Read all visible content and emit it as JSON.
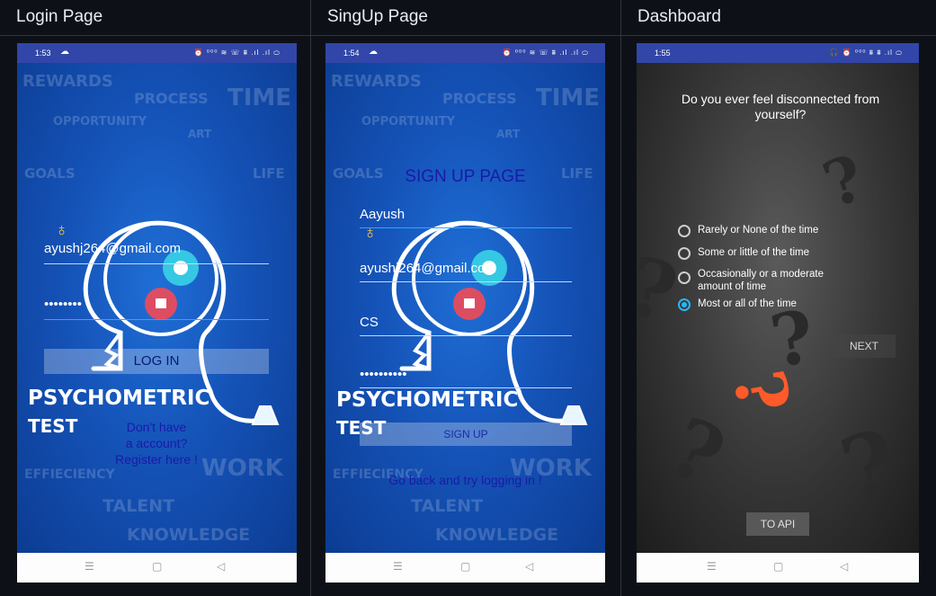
{
  "columns": [
    "Login Page",
    "SingUp Page",
    "Dashboard"
  ],
  "login": {
    "time": "1:53",
    "status_icons": "⏰ ⁰⁰⁰ ≋ ☏ ⩩ .ıl .ıl ⬭",
    "email_value": "ayushj264@gmail.com",
    "password_value": "••••••••",
    "login_button": "LOG IN",
    "brand_line1": "PSYCHOMETRIC",
    "brand_line2": "TEST",
    "register_text": "Don't have\na account?\nRegister here !"
  },
  "signup": {
    "time": "1:54",
    "status_icons": "⏰ ⁰⁰⁰ ≋ ☏ ⩩ .ıl .ıl ⬭",
    "title": "SIGN UP PAGE",
    "name_value": "Aayush",
    "email_value": "ayushj264@gmail.com",
    "branch_value": "CS",
    "password_value": "••••••••••",
    "signup_button": "SIGN UP",
    "back_link": "Go back and try logging in !",
    "brand_line1": "PSYCHOMETRIC",
    "brand_line2": "TEST"
  },
  "dashboard": {
    "time": "1:55",
    "status_icons": "🎧 ⏰ ⁰⁰⁰ ⩩ ⩩ .ıl ⬭",
    "question": "Do you ever feel disconnected from yourself?",
    "options": [
      {
        "label": "Rarely or None of the time",
        "checked": false
      },
      {
        "label": "Some or little of the time",
        "checked": false
      },
      {
        "label": "Occasionally or a moderate amount of time",
        "checked": false
      },
      {
        "label": "Most or all of the time",
        "checked": true
      }
    ],
    "next_button": "NEXT",
    "api_button": "TO API"
  },
  "bg_words": [
    "REWARDS",
    "PROCESS",
    "TIME",
    "OPPORTUNITY",
    "ART",
    "GOALS",
    "LIFE",
    "EFFIECIENCY",
    "WORK",
    "TALENT",
    "KNOWLEDGE"
  ],
  "nav": {
    "menu": "☰",
    "home": "▢",
    "back": "◁"
  },
  "colors": {
    "accent": "#29b6f6",
    "status_bar": "#3146a8",
    "bg": "#0d1117",
    "qmark": "#ff5a2a"
  }
}
